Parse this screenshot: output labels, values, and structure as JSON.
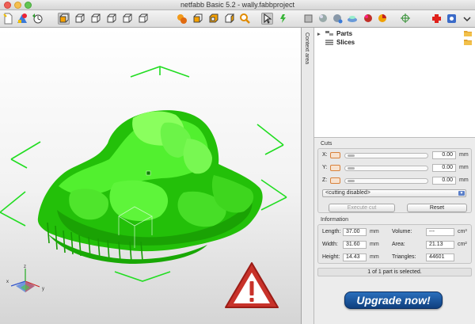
{
  "window": {
    "title": "netfabb Basic 5.2 - wally.fabbproject"
  },
  "toolbar": {
    "left_icons": [
      "new-file-icon",
      "add-part-icon",
      "open-project-icon",
      "view-front-icon",
      "view-back-icon",
      "view-left-icon",
      "view-right-icon",
      "view-top-icon",
      "view-bottom-icon",
      "view-iso-icon",
      "zoom-icon",
      "pointer-icon",
      "rotate-icon"
    ],
    "right_icons": [
      "shading-icon",
      "sphere-icon",
      "sphere-hover-icon",
      "layers-icon",
      "sphere-red-icon",
      "pie-icon",
      "crosshair-icon",
      "repair-cross-icon",
      "settings-icon",
      "help-icon"
    ]
  },
  "context_area": {
    "label": "Context area"
  },
  "tree": {
    "items": [
      {
        "label": "Parts"
      },
      {
        "label": "Slices"
      }
    ]
  },
  "cuts": {
    "title": "Cuts",
    "axes": [
      {
        "axis": "X:",
        "value": "0.00",
        "unit": "mm"
      },
      {
        "axis": "Y:",
        "value": "0.00",
        "unit": "mm"
      },
      {
        "axis": "Z:",
        "value": "0.00",
        "unit": "mm"
      }
    ],
    "mode": "<cutting disabled>",
    "execute_label": "Execute cut",
    "reset_label": "Reset"
  },
  "information": {
    "title": "Information",
    "length_label": "Length:",
    "length_value": "37.00",
    "length_unit": "mm",
    "width_label": "Width:",
    "width_value": "31.60",
    "width_unit": "mm",
    "height_label": "Height:",
    "height_value": "14.43",
    "height_unit": "mm",
    "volume_label": "Volume:",
    "volume_value": "---",
    "volume_unit": "cm³",
    "area_label": "Area:",
    "area_value": "21.13",
    "area_unit": "cm²",
    "triangles_label": "Triangles:",
    "triangles_value": "44601"
  },
  "status_text": "1 of 1 part is selected.",
  "upgrade_label": "Upgrade now!",
  "colors": {
    "model": "#2fd40d",
    "selection_brackets": "#22dd22",
    "warning_red": "#c8322a",
    "upgrade_blue": "#1d57a0"
  }
}
